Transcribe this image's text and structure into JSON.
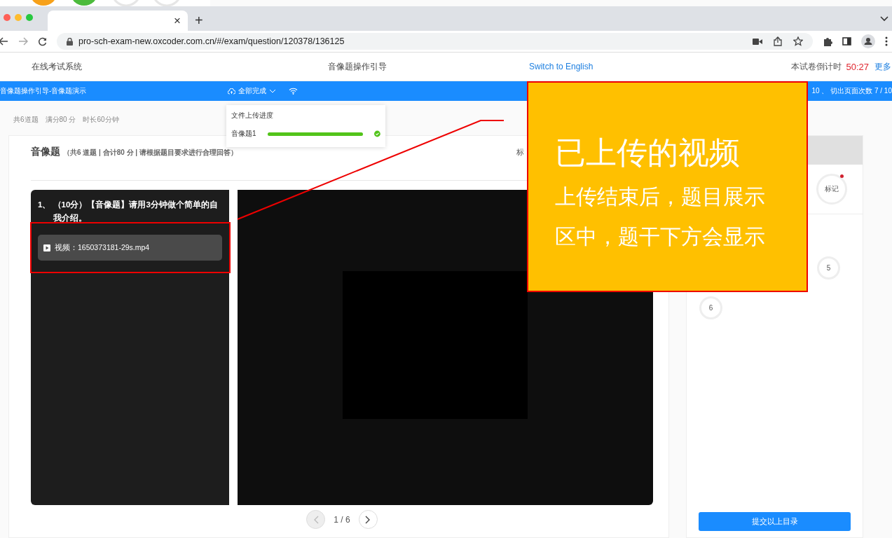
{
  "browser": {
    "tab_close": "×",
    "new_tab": "+",
    "url": "pro-sch-exam-new.oxcoder.com.cn/#/exam/question/120378/136125"
  },
  "header": {
    "system_name": "在线考试系统",
    "page_title": "音像题操作引导",
    "language_link": "Switch to English",
    "countdown_label": "本试卷倒计时",
    "countdown": "50:27",
    "more_link": "更多"
  },
  "status_bar": {
    "exam_title": "音像题操作引导-音像题演示",
    "upload_status": "全部完成",
    "tab_switch_info": "10 、 切出页面次数 7 / 10"
  },
  "upload_panel": {
    "title": "文件上传进度",
    "items": [
      {
        "name": "音像题1",
        "level": 1,
        "done": true
      }
    ]
  },
  "exam_summary": [
    "共6道题",
    "满分80 分",
    "时长60分钟"
  ],
  "section": {
    "title": "音像题",
    "detail": "（共6 道题 | 合计80 分 | 请根据题目要求进行合理回答）",
    "mark_label": "标"
  },
  "question": {
    "text": "1、 （10分）【音像题】请用3分钟做个简单的自我介绍。",
    "attachment": "视频：1650373181-29s.mp4"
  },
  "pagination": {
    "page": "1 / 6",
    "prev_disabled": true,
    "next_disabled": false
  },
  "answer_card": {
    "mark_button": "标记",
    "marked": true,
    "questions": [
      {
        "number": "5"
      },
      {
        "number": "6"
      }
    ],
    "submit": "提交以上目录"
  },
  "callout": {
    "title": "已上传的视频",
    "body": "上传结束后，题目展示区中，题干下方会显示"
  }
}
